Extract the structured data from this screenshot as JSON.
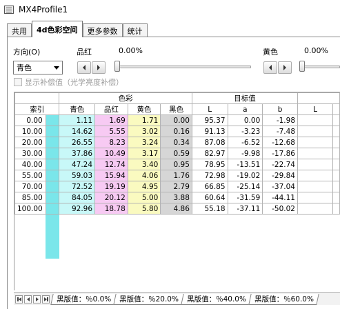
{
  "window": {
    "title": "MX4Profile1"
  },
  "tabs": [
    {
      "label": "共用",
      "active": false
    },
    {
      "label": "4d色彩空间",
      "active": true
    },
    {
      "label": "更多参数",
      "active": false
    },
    {
      "label": "统计",
      "active": false
    }
  ],
  "controls": {
    "direction_label": "方向(O)",
    "direction_value": "青色",
    "magenta_label": "品红",
    "magenta_value": "0.00%",
    "magenta_level": 0,
    "yellow_label": "黄色",
    "yellow_value": "0.00%",
    "yellow_level": 0,
    "show_comp_label": "显示补偿值（光学亮度补偿）",
    "show_comp_enabled": false
  },
  "table": {
    "group_headers": {
      "color": "色彩",
      "target": "目标值"
    },
    "columns": {
      "index": "索引",
      "cyan": "青色",
      "magenta": "品红",
      "yellow": "黄色",
      "black": "黑色",
      "L": "L",
      "a": "a",
      "b": "b",
      "L2": "L"
    },
    "colors": {
      "cyan": "#c8f8f8",
      "cyan_swatch": "#7ae6ea",
      "magenta": "#f7caf3",
      "yellow": "#fafac0",
      "black": "#d6d6d6"
    },
    "rows": [
      {
        "index": "0.00",
        "cyan": "1.11",
        "magenta": "1.69",
        "yellow": "1.71",
        "black": "0.00",
        "L": "95.37",
        "a": "0.00",
        "b": "-1.98"
      },
      {
        "index": "10.00",
        "cyan": "14.62",
        "magenta": "5.55",
        "yellow": "3.02",
        "black": "0.16",
        "L": "91.13",
        "a": "-3.23",
        "b": "-7.48"
      },
      {
        "index": "20.00",
        "cyan": "26.55",
        "magenta": "8.23",
        "yellow": "3.24",
        "black": "0.34",
        "L": "87.08",
        "a": "-6.52",
        "b": "-12.68"
      },
      {
        "index": "30.00",
        "cyan": "37.86",
        "magenta": "10.49",
        "yellow": "3.17",
        "black": "0.59",
        "L": "82.97",
        "a": "-9.98",
        "b": "-17.86"
      },
      {
        "index": "40.00",
        "cyan": "47.24",
        "magenta": "12.74",
        "yellow": "3.40",
        "black": "0.95",
        "L": "78.95",
        "a": "-13.51",
        "b": "-22.74"
      },
      {
        "index": "55.00",
        "cyan": "59.03",
        "magenta": "15.94",
        "yellow": "4.06",
        "black": "1.76",
        "L": "72.98",
        "a": "-19.02",
        "b": "-29.84"
      },
      {
        "index": "70.00",
        "cyan": "72.52",
        "magenta": "19.19",
        "yellow": "4.95",
        "black": "2.79",
        "L": "66.85",
        "a": "-25.14",
        "b": "-37.04"
      },
      {
        "index": "85.00",
        "cyan": "84.05",
        "magenta": "20.12",
        "yellow": "5.00",
        "black": "3.88",
        "L": "60.64",
        "a": "-31.59",
        "b": "-44.11"
      },
      {
        "index": "100.00",
        "cyan": "92.96",
        "magenta": "18.78",
        "yellow": "5.80",
        "black": "4.86",
        "L": "55.18",
        "a": "-37.11",
        "b": "-50.02"
      }
    ]
  },
  "sheet_tabs": [
    {
      "label": "黑版值：％0.0%",
      "active": true
    },
    {
      "label": "黑版值：％20.0%",
      "active": false
    },
    {
      "label": "黑版值：％40.0%",
      "active": false
    },
    {
      "label": "黑版值：％60.0%",
      "active": false
    }
  ]
}
